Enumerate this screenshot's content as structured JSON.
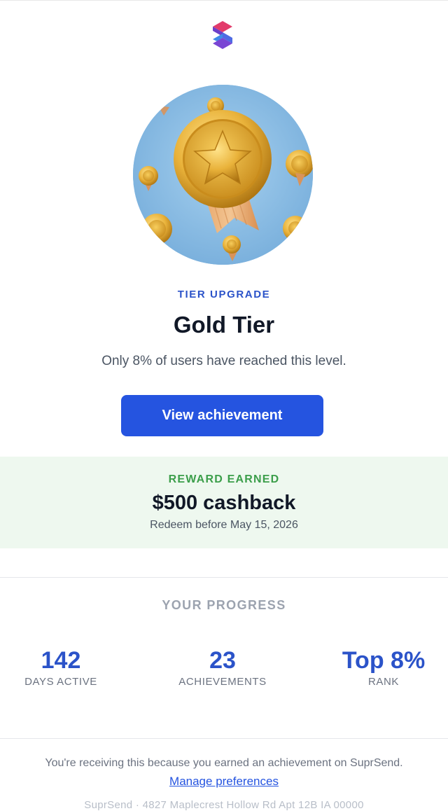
{
  "brand": {
    "logo_icon": "suprsend-logo-icon",
    "accent": "#2554e0"
  },
  "hero": {
    "image": "gold-medal-illustration",
    "background": "#7fb6e0"
  },
  "achievement": {
    "eyebrow": "TIER UPGRADE",
    "title": "Gold Tier",
    "subtitle": "Only 8% of users have reached this level.",
    "cta_label": "View achievement"
  },
  "reward": {
    "label": "REWARD EARNED",
    "amount": "$500 cashback",
    "note": "Redeem before May 15, 2026",
    "background": "#eef8ef",
    "label_color": "#3b9e4a"
  },
  "progress": {
    "heading": "YOUR PROGRESS",
    "stats": [
      {
        "value": "142",
        "label": "DAYS ACTIVE"
      },
      {
        "value": "23",
        "label": "ACHIEVEMENTS"
      },
      {
        "value": "Top 8%",
        "label": "RANK"
      }
    ]
  },
  "footer": {
    "notice": "You're receiving this because you earned an achievement on SuprSend.",
    "link_label": "Manage preferences",
    "address": "SuprSend · 4827 Maplecrest Hollow Rd Apt 12B IA 00000"
  }
}
